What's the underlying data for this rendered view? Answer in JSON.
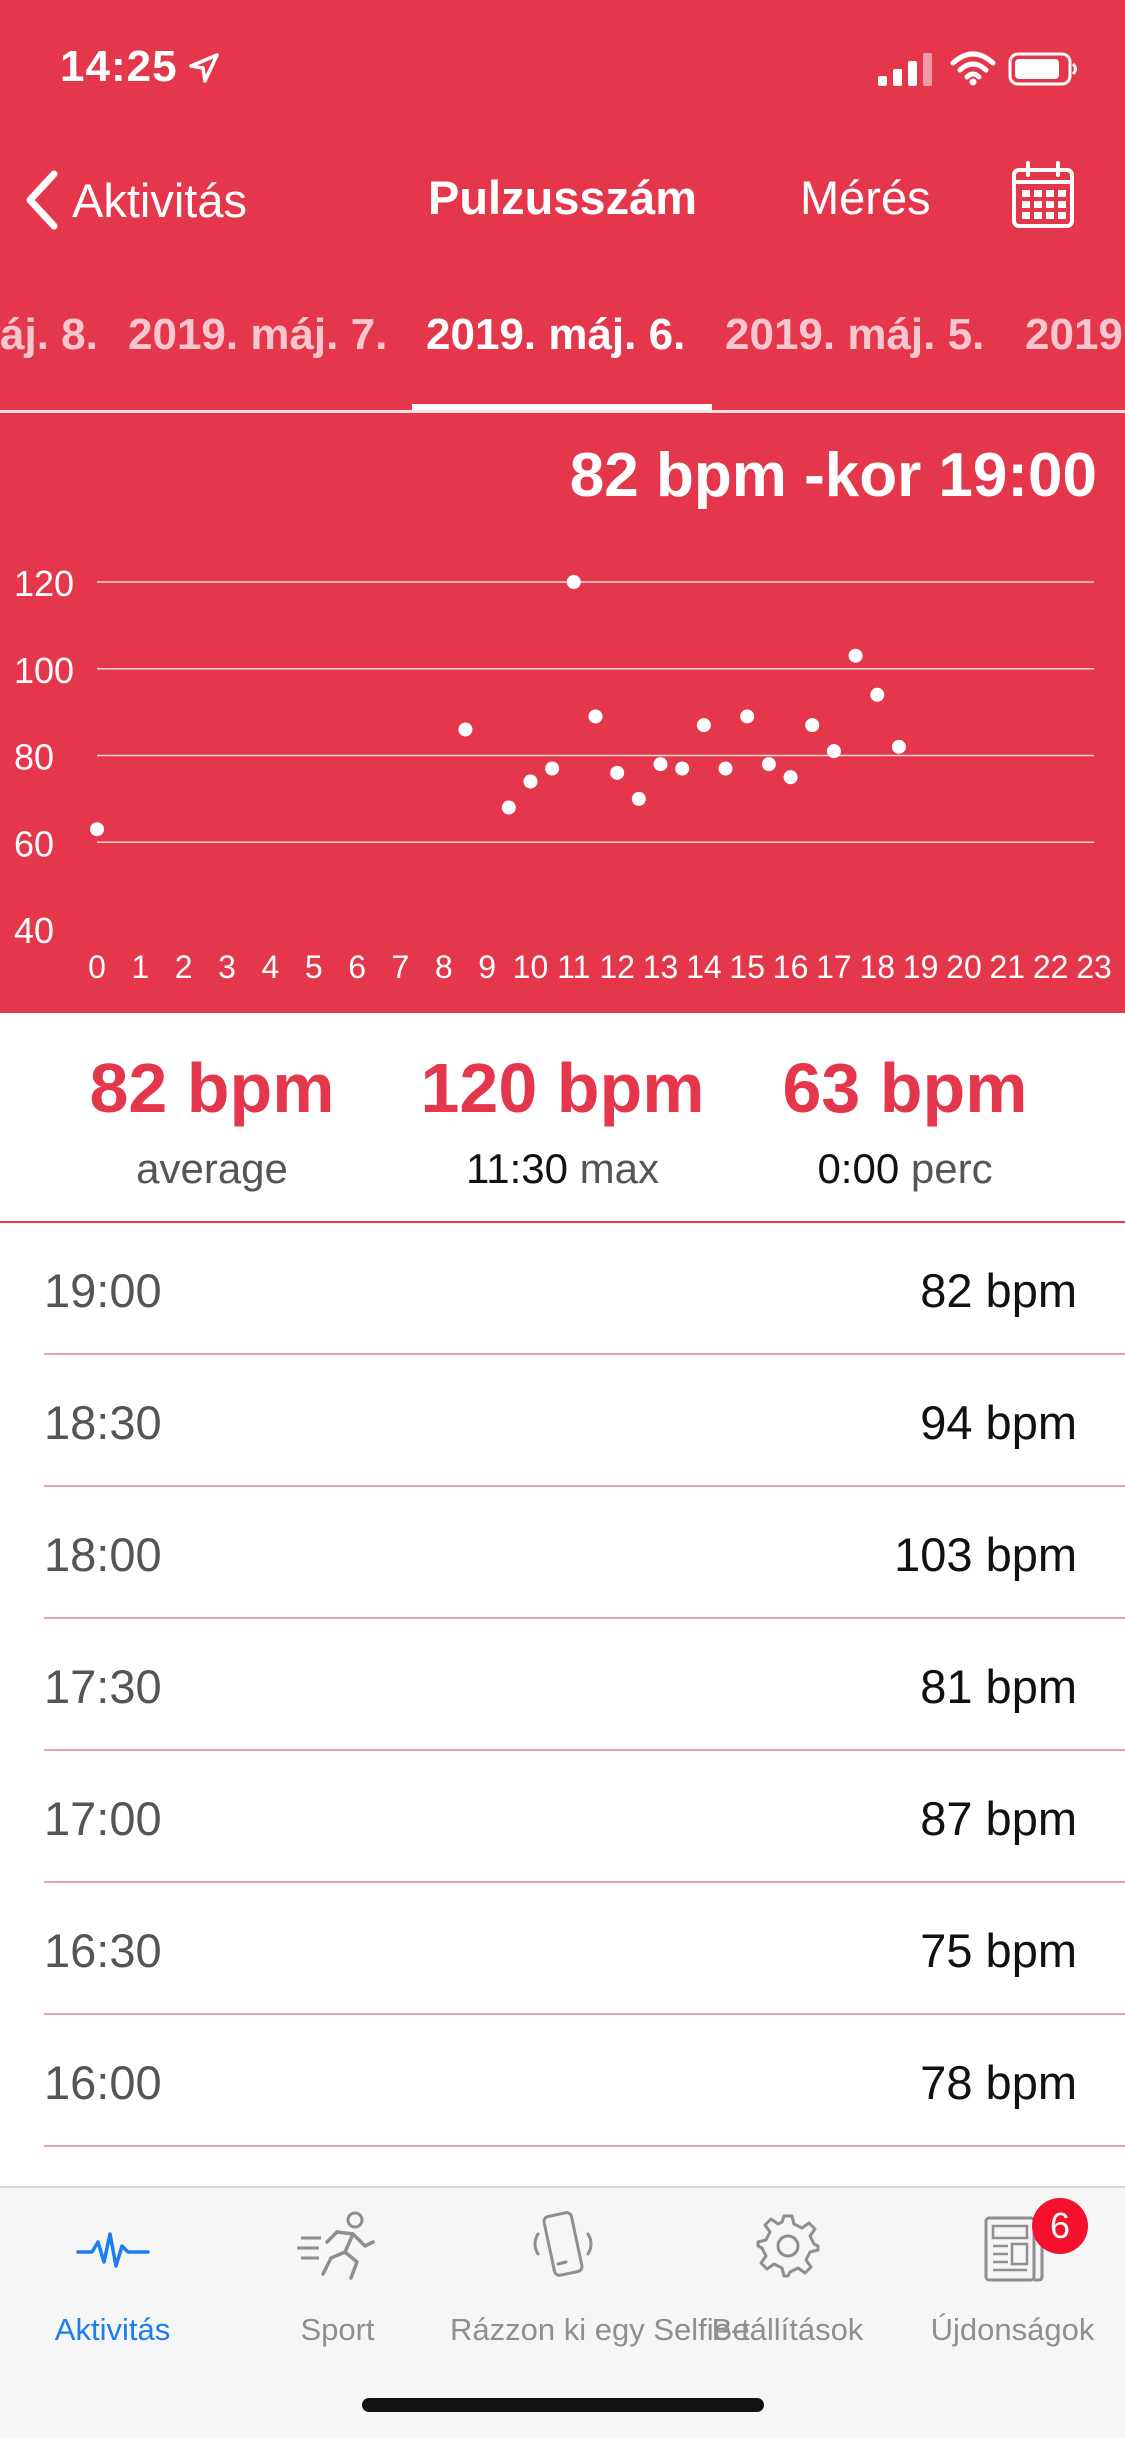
{
  "status_bar": {
    "time": "14:25"
  },
  "nav": {
    "back_label": "Aktivitás",
    "title": "Pulzusszám",
    "action_label": "Mérés"
  },
  "date_tabs": [
    {
      "label": "áj. 8.",
      "active": false
    },
    {
      "label": "2019. máj. 7.",
      "active": false
    },
    {
      "label": "2019. máj. 6.",
      "active": true
    },
    {
      "label": "2019. máj. 5.",
      "active": false
    },
    {
      "label": "2019",
      "active": false
    }
  ],
  "chart_headline": "82 bpm -kor 19:00",
  "chart_data": {
    "type": "scatter",
    "title": "",
    "xlabel": "",
    "ylabel": "",
    "xlim": [
      0,
      23
    ],
    "ylim": [
      40,
      120
    ],
    "x_ticks": [
      0,
      1,
      2,
      3,
      4,
      5,
      6,
      7,
      8,
      9,
      10,
      11,
      12,
      13,
      14,
      15,
      16,
      17,
      18,
      19,
      20,
      21,
      22,
      23
    ],
    "y_ticks": [
      40,
      60,
      80,
      100,
      120
    ],
    "grid": true,
    "points": [
      {
        "x": 0,
        "y": 63
      },
      {
        "x": 8.5,
        "y": 86
      },
      {
        "x": 9.5,
        "y": 68
      },
      {
        "x": 10,
        "y": 74
      },
      {
        "x": 10.5,
        "y": 77
      },
      {
        "x": 11,
        "y": 120
      },
      {
        "x": 11.5,
        "y": 89
      },
      {
        "x": 12,
        "y": 76
      },
      {
        "x": 12.5,
        "y": 70
      },
      {
        "x": 13,
        "y": 78
      },
      {
        "x": 13.5,
        "y": 77
      },
      {
        "x": 14,
        "y": 87
      },
      {
        "x": 14.5,
        "y": 77
      },
      {
        "x": 15,
        "y": 89
      },
      {
        "x": 15.5,
        "y": 78
      },
      {
        "x": 16,
        "y": 75
      },
      {
        "x": 16.5,
        "y": 87
      },
      {
        "x": 17,
        "y": 81
      },
      {
        "x": 17.5,
        "y": 103
      },
      {
        "x": 18,
        "y": 94
      },
      {
        "x": 18.5,
        "y": 82
      }
    ]
  },
  "summary": {
    "average": {
      "value": "82 bpm",
      "label": "average"
    },
    "max": {
      "value": "120 bpm",
      "time": "11:30",
      "label": "max"
    },
    "min": {
      "value": "63 bpm",
      "time": "0:00",
      "label": "perc"
    }
  },
  "readings": [
    {
      "time": "19:00",
      "value": "82 bpm"
    },
    {
      "time": "18:30",
      "value": "94 bpm"
    },
    {
      "time": "18:00",
      "value": "103 bpm"
    },
    {
      "time": "17:30",
      "value": "81 bpm"
    },
    {
      "time": "17:00",
      "value": "87 bpm"
    },
    {
      "time": "16:30",
      "value": "75 bpm"
    },
    {
      "time": "16:00",
      "value": "78 bpm"
    }
  ],
  "tab_bar": {
    "items": [
      {
        "label": "Aktivitás",
        "icon": "heartbeat-icon",
        "active": true
      },
      {
        "label": "Sport",
        "icon": "running-person-icon",
        "active": false
      },
      {
        "label": "Rázzon ki egy Selfie-t",
        "icon": "shaking-phone-icon",
        "active": false
      },
      {
        "label": "Beállítások",
        "icon": "gear-icon",
        "active": false
      },
      {
        "label": "Újdonságok",
        "icon": "newspaper-icon",
        "active": false
      }
    ],
    "badge_count": "6"
  },
  "colors": {
    "accent_red": "#e4374c",
    "active_tab_blue": "#1c7cf2",
    "inactive_gray": "#8e8e93",
    "badge_red": "#f5102e"
  }
}
